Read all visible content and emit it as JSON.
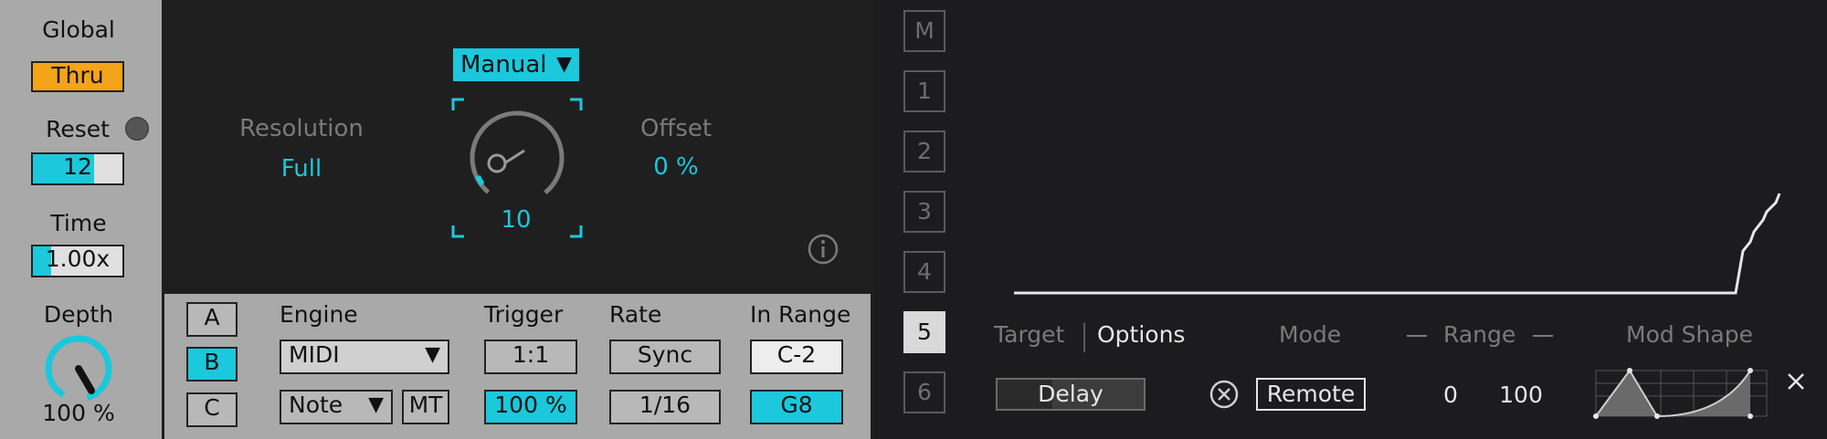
{
  "left": {
    "global_label": "Global",
    "global_value": "Thru",
    "reset_label": "Reset",
    "reset_value": "12",
    "reset_fill": 0.68,
    "time_label": "Time",
    "time_value": "1.00x",
    "time_fill": 0.2,
    "depth_label": "Depth",
    "depth_value": "100 %"
  },
  "top": {
    "mode_dropdown": "Manual",
    "resolution_label": "Resolution",
    "resolution_value": "Full",
    "offset_label": "Offset",
    "offset_value": "0 %",
    "knob_value": "10",
    "info_icon": "info-icon"
  },
  "bottom": {
    "slots": [
      "A",
      "B",
      "C"
    ],
    "selected_slot": "B",
    "engine_label": "Engine",
    "engine_value": "MIDI",
    "engine_sub_value": "Note",
    "mt_label": "MT",
    "trigger_label": "Trigger",
    "trigger_top": "1:1",
    "trigger_bottom": "100 %",
    "rate_label": "Rate",
    "rate_top": "Sync",
    "rate_bottom": "1/16",
    "inrange_label": "In Range",
    "inrange_top": "C-2",
    "inrange_bottom": "G8"
  },
  "right": {
    "slots": [
      "M",
      "1",
      "2",
      "3",
      "4",
      "5",
      "6"
    ],
    "selected_slot": "5",
    "tab_target": "Target",
    "tab_options": "Options",
    "mode_label": "Mode",
    "range_label": "Range",
    "modshape_label": "Mod Shape",
    "target_value": "Delay",
    "mode_value": "Remote",
    "range_min": "0",
    "range_max": "100",
    "close_icon": "close-icon",
    "clear_icon": "clear-circle-icon"
  },
  "colors": {
    "accent": "#1bc8dc",
    "orange": "#f4a418",
    "panel_gray": "#a9a9a9",
    "panel_dark": "#1f1f1f"
  }
}
